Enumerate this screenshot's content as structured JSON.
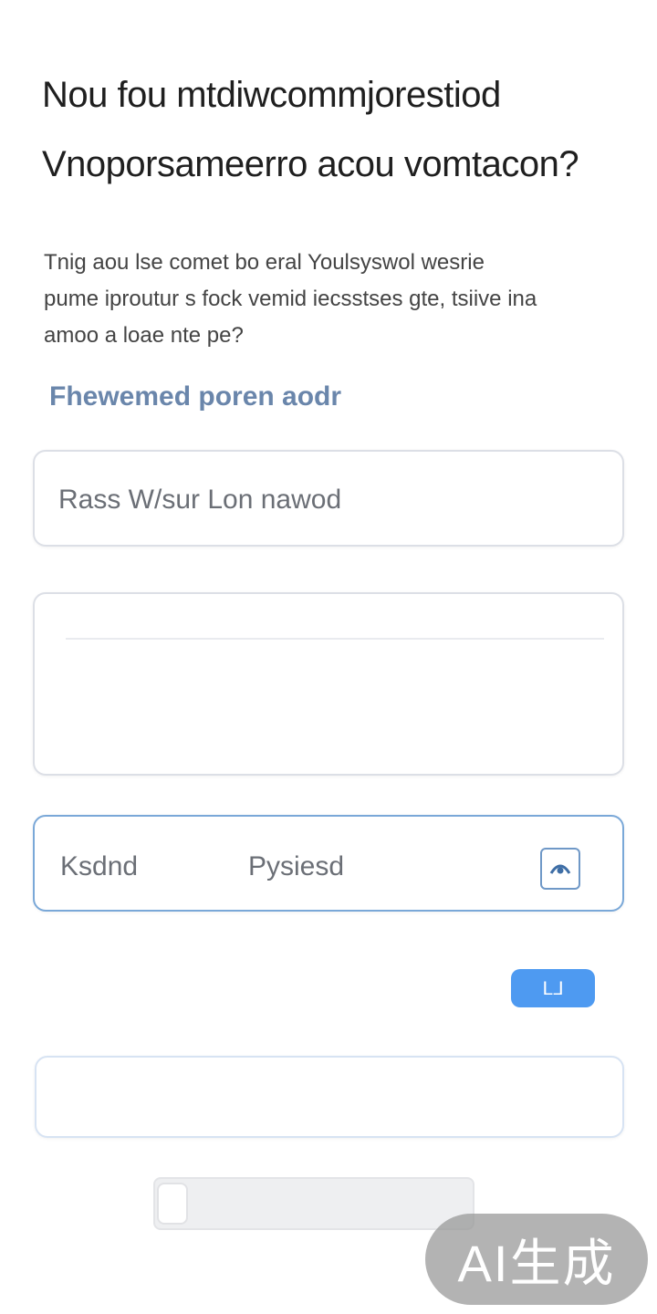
{
  "heading": {
    "line1": "Nou fou mtdiwcommjorestiod",
    "line2": "Vnoporsameerro acou vomtacon?"
  },
  "description": {
    "line1": "Tnig aou lse comet bo eral Youlsyswol wesrie",
    "line2": "pume iproutur s fock vemid iecsstses gte, tsiive ina",
    "line3": "amoo a loae nte pe?"
  },
  "section_label": "Fhewemed poren aodr",
  "form": {
    "field1_placeholder": "Rass W/sur Lon nawod",
    "field3_left_label": "Ksdnd",
    "field3_right_label": "Pysiesd",
    "toggle_icon": "eye-icon",
    "submit_label": "ᒪᒧ"
  },
  "slider": {
    "value": 0
  },
  "watermark": "AI生成",
  "colors": {
    "accent": "#4e9af1",
    "focus_border": "#7aa8d8",
    "label_blue": "#6a86ab"
  }
}
